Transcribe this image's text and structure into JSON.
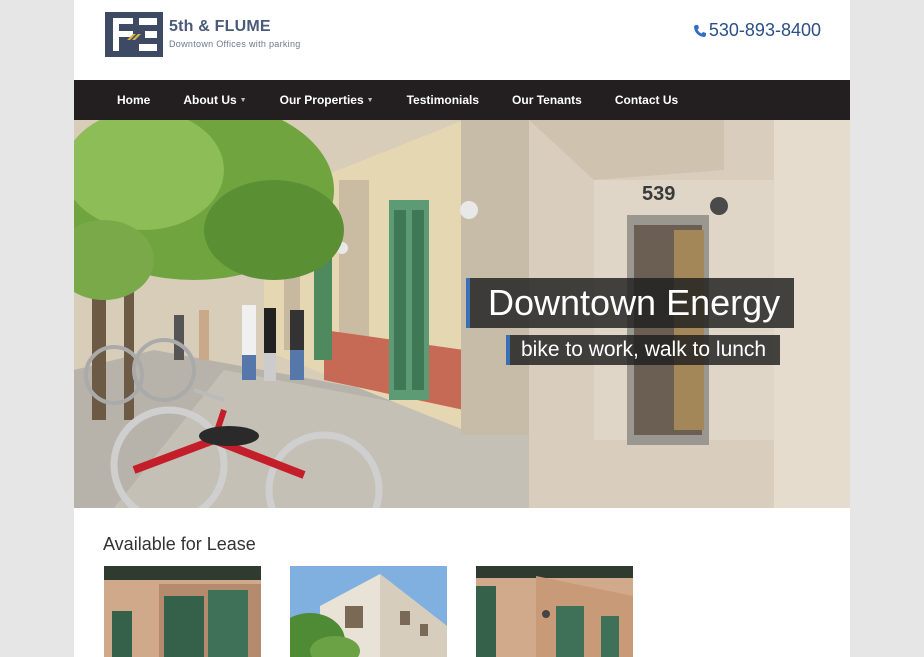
{
  "logo": {
    "title": "5th & FLUME",
    "subtitle": "Downtown Offices with parking",
    "icon": "logo-mark-icon"
  },
  "header": {
    "phone": "530-893-8400",
    "phone_icon": "phone-icon",
    "phone_color": "#2b4f86"
  },
  "nav": {
    "items": [
      {
        "label": "Home",
        "has_dropdown": false
      },
      {
        "label": "About Us",
        "has_dropdown": true
      },
      {
        "label": "Our Properties",
        "has_dropdown": true
      },
      {
        "label": "Testimonials",
        "has_dropdown": false
      },
      {
        "label": "Our Tenants",
        "has_dropdown": false
      },
      {
        "label": "Contact Us",
        "has_dropdown": false
      }
    ],
    "dropdown_icon": "chevron-down-icon",
    "background": "#231f20"
  },
  "hero": {
    "title": "Downtown Energy",
    "subtitle": "bike to work, walk to lunch",
    "building_number": "539",
    "accent": "#3b6fb5"
  },
  "lease": {
    "heading": "Available for Lease",
    "listings": [
      {
        "name": "listing-photo-1"
      },
      {
        "name": "listing-photo-2"
      },
      {
        "name": "listing-photo-3"
      }
    ]
  }
}
